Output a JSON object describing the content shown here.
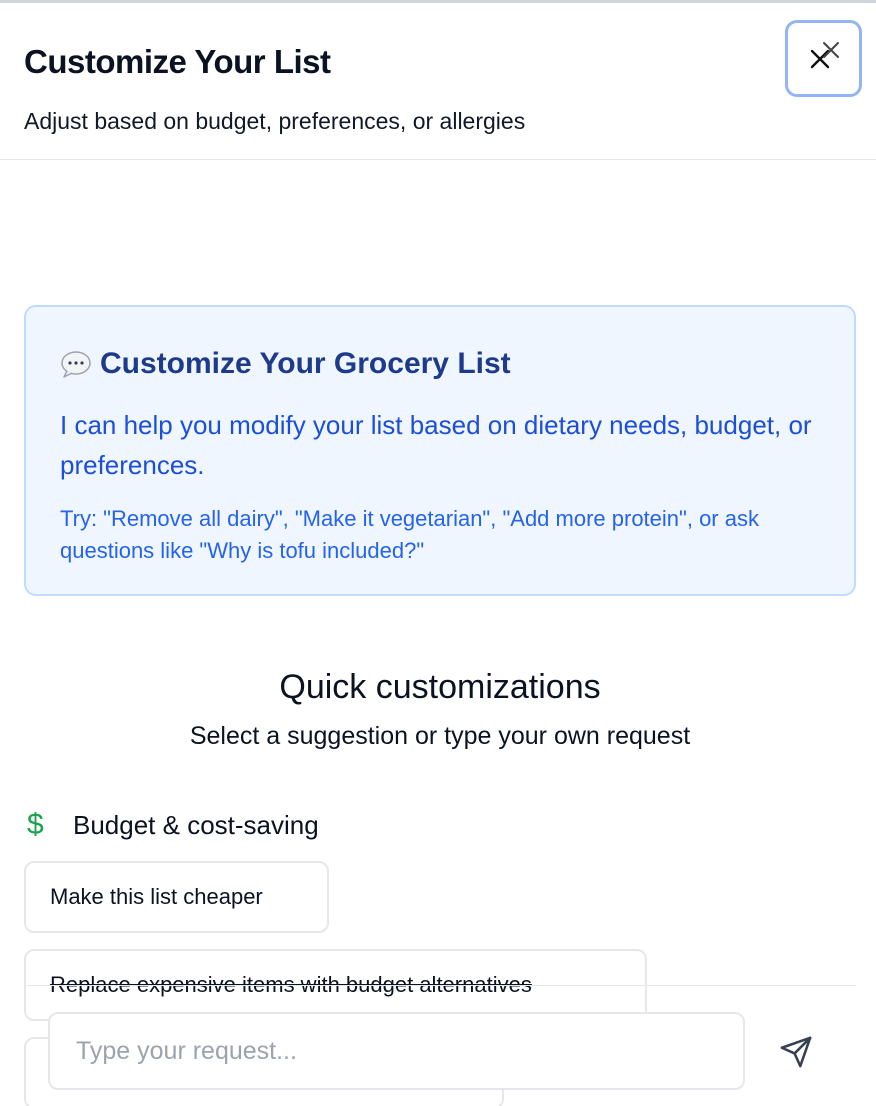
{
  "header": {
    "title": "Customize Your List",
    "subtitle": "Adjust based on budget, preferences, or allergies",
    "close_icon": "close-icon"
  },
  "info_card": {
    "icon": "chat-bubble-icon",
    "title": "Customize Your Grocery List",
    "description": "I can help you modify your list based on dietary needs, budget, or preferences.",
    "tip": "Try: \"Remove all dairy\", \"Make it vegetarian\", \"Add more protein\", or ask questions like \"Why is tofu included?\""
  },
  "quick": {
    "title": "Quick customizations",
    "subtitle": "Select a suggestion or type your own request",
    "category": {
      "icon": "dollar-icon",
      "icon_glyph": "$",
      "label": "Budget & cost-saving",
      "color": "#16a34a"
    },
    "suggestions": [
      "Make this list cheaper",
      "Replace expensive items with budget alternatives",
      ""
    ]
  },
  "composer": {
    "placeholder": "Type your request...",
    "send_icon": "send-icon"
  },
  "colors": {
    "accent_blue": "#1d4ed8",
    "card_bg": "#eff6ff",
    "card_border": "#bfdbfe",
    "focus_ring": "#93b4f5"
  }
}
